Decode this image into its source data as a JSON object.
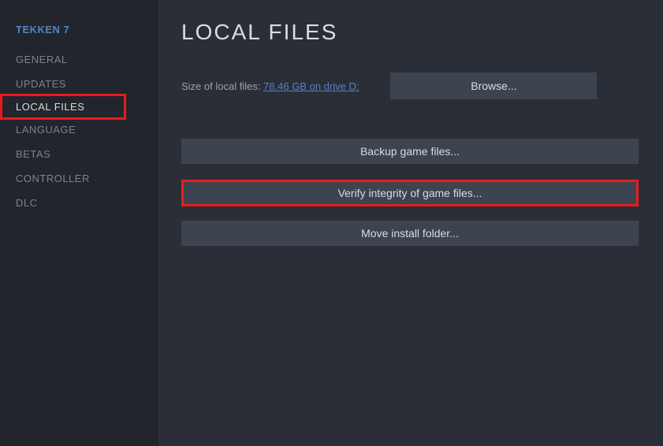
{
  "sidebar": {
    "gameTitle": "TEKKEN 7",
    "items": [
      {
        "label": "GENERAL"
      },
      {
        "label": "UPDATES"
      },
      {
        "label": "LOCAL FILES"
      },
      {
        "label": "LANGUAGE"
      },
      {
        "label": "BETAS"
      },
      {
        "label": "CONTROLLER"
      },
      {
        "label": "DLC"
      }
    ]
  },
  "main": {
    "title": "LOCAL FILES",
    "sizeLabel": "Size of local files: ",
    "sizeValue": "78.46 GB on drive D:",
    "browseBtn": "Browse...",
    "backupBtn": "Backup game files...",
    "verifyBtn": "Verify integrity of game files...",
    "moveBtn": "Move install folder..."
  }
}
